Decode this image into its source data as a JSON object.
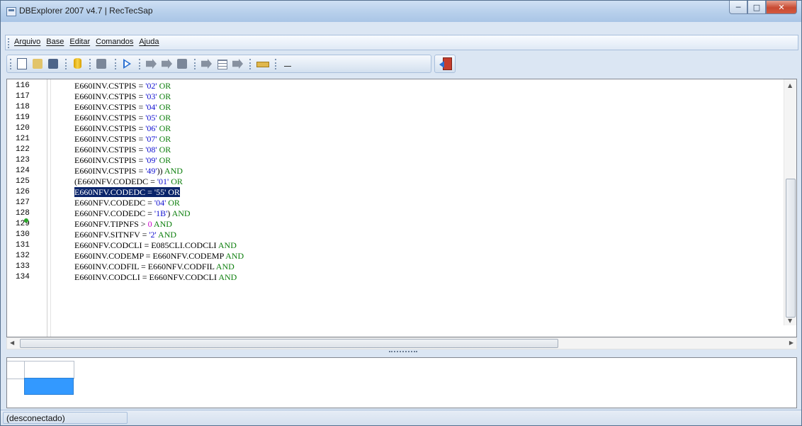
{
  "window": {
    "title": "DBExplorer 2007 v4.7 | RecTecSap"
  },
  "menubar": {
    "items": [
      "Arquivo",
      "Base",
      "Editar",
      "Comandos",
      "Ajuda"
    ]
  },
  "toolbar": {
    "icons": [
      "new-document-icon",
      "open-folder-icon",
      "save-disk-icon",
      "database-icon",
      "table-gray-icon",
      "run-play-icon",
      "first-record-icon",
      "edit-record-icon",
      "next-record-icon",
      "prev-record-icon",
      "list-view-icon",
      "last-record-icon",
      "ruler-icon",
      "dash-icon",
      "exit-door-icon"
    ]
  },
  "editor": {
    "lines": [
      {
        "num": "116",
        "code": "E660INV.CSTPIS = '02' OR"
      },
      {
        "num": "117",
        "code": "E660INV.CSTPIS = '03' OR"
      },
      {
        "num": "118",
        "code": "E660INV.CSTPIS = '04' OR"
      },
      {
        "num": "119",
        "code": "E660INV.CSTPIS = '05' OR"
      },
      {
        "num": "120",
        "code": "E660INV.CSTPIS = '06' OR"
      },
      {
        "num": "121",
        "code": "E660INV.CSTPIS = '07' OR"
      },
      {
        "num": "122",
        "code": "E660INV.CSTPIS = '08' OR"
      },
      {
        "num": "123",
        "code": "E660INV.CSTPIS = '09' OR"
      },
      {
        "num": "124",
        "code": "E660INV.CSTPIS = '49')) AND"
      },
      {
        "num": "125",
        "code": "(E660NFV.CODEDC = '01' OR"
      },
      {
        "num": "126",
        "code": "E660NFV.CODEDC = '55' OR"
      },
      {
        "num": "127",
        "code": "E660NFV.CODEDC = '04' OR"
      },
      {
        "num": "128",
        "code": "E660NFV.CODEDC = '1B') AND"
      },
      {
        "num": "129",
        "code": "E660NFV.TIPNFS > 0 AND"
      },
      {
        "num": "130",
        "code": "E660NFV.SITNFV = '2' AND"
      },
      {
        "num": "131",
        "code": "E660NFV.CODCLI = E085CLI.CODCLI AND"
      },
      {
        "num": "132",
        "code": "E660INV.CODEMP = E660NFV.CODEMP AND"
      },
      {
        "num": "133",
        "code": "E660INV.CODFIL = E660NFV.CODFIL AND"
      },
      {
        "num": "134",
        "code": "E660INV.CODCLI = E660NFV.CODCLI AND"
      }
    ],
    "selected_line": "126"
  },
  "statusbar": {
    "connection": "(desconectado)"
  },
  "colors": {
    "keyword": "#0d7f0d",
    "string": "#1010d0",
    "number": "#cc00cc",
    "selection": "#0a246a",
    "grid_selected": "#3399ff"
  }
}
